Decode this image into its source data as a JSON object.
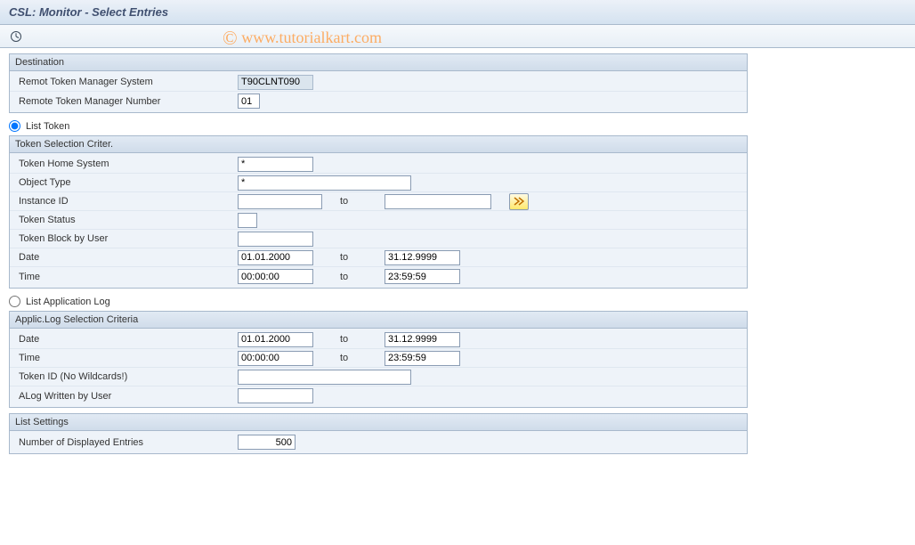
{
  "title": "CSL: Monitor - Select Entries",
  "watermark": "www.tutorialkart.com",
  "destination": {
    "legend": "Destination",
    "remote_system_label": "Remot Token Manager System",
    "remote_system_value": "T90CLNT090",
    "remote_number_label": "Remote Token Manager Number",
    "remote_number_value": "01"
  },
  "radio_list_token": "List Token",
  "token_criteria": {
    "legend": "Token Selection Criter.",
    "home_system_label": "Token Home System",
    "home_system_value": "*",
    "object_type_label": "Object Type",
    "object_type_value": "*",
    "instance_id_label": "Instance ID",
    "instance_id_from": "",
    "instance_to_label": "to",
    "instance_id_to": "",
    "token_status_label": "Token Status",
    "token_status_value": "",
    "token_block_user_label": "Token Block by User",
    "token_block_user_value": "",
    "date_label": "Date",
    "date_from": "01.01.2000",
    "date_to_label": "to",
    "date_to": "31.12.9999",
    "time_label": "Time",
    "time_from": "00:00:00",
    "time_to_label": "to",
    "time_to": "23:59:59"
  },
  "radio_app_log": "List Application Log",
  "applog": {
    "legend": "Applic.Log Selection Criteria",
    "date_label": "Date",
    "date_from": "01.01.2000",
    "date_to_label": "to",
    "date_to": "31.12.9999",
    "time_label": "Time",
    "time_from": "00:00:00",
    "time_to_label": "to",
    "time_to": "23:59:59",
    "token_id_label": "Token ID (No Wildcards!)",
    "token_id_value": "",
    "alog_user_label": "ALog Written by User",
    "alog_user_value": ""
  },
  "list_settings": {
    "legend": "List Settings",
    "displayed_label": "Number of Displayed Entries",
    "displayed_value": "500"
  }
}
